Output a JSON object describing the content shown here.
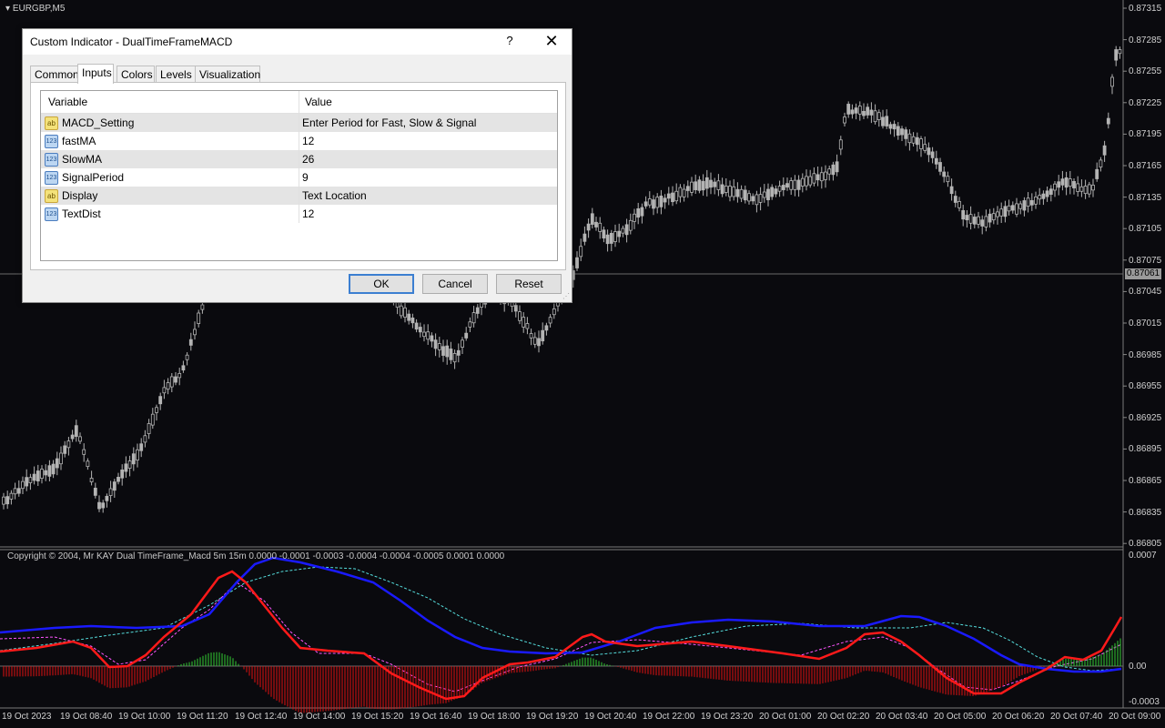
{
  "chart": {
    "symbol": "EURGBP,M5",
    "current_price": "0.87061",
    "price_axis": [
      "0.87315",
      "0.87285",
      "0.87255",
      "0.87225",
      "0.87195",
      "0.87165",
      "0.87135",
      "0.87105",
      "0.87075",
      "0.87045",
      "0.87015",
      "0.86985",
      "0.86955",
      "0.86925",
      "0.86895",
      "0.86865",
      "0.86835",
      "0.86805"
    ],
    "time_axis": [
      "19 Oct 2023",
      "19 Oct 08:40",
      "19 Oct 10:00",
      "19 Oct 11:20",
      "19 Oct 12:40",
      "19 Oct 14:00",
      "19 Oct 15:20",
      "19 Oct 16:40",
      "19 Oct 18:00",
      "19 Oct 19:20",
      "19 Oct 20:40",
      "19 Oct 22:00",
      "19 Oct 23:20",
      "20 Oct 01:00",
      "20 Oct 02:20",
      "20 Oct 03:40",
      "20 Oct 05:00",
      "20 Oct 06:20",
      "20 Oct 07:40",
      "20 Oct 09:00"
    ],
    "subwindow_caption": "Copyright © 2004, Mr KAY Dual TimeFrame_Macd 5m 15m  0.0000 -0.0001 -0.0003 -0.0004 -0.0004 -0.0005 0.0001 0.0000",
    "subwindow_axis": [
      "0.0007",
      "0.00",
      "-0.0003"
    ],
    "colors": {
      "background": "#0a0a0e",
      "candles": "#b4b4b4",
      "macd_fast": "#ff1a1a",
      "macd_slow": "#1a1aff",
      "signal_pink": "#ff55ff",
      "signal_cyan": "#55dddd",
      "hist_up": "#33cc33",
      "hist_down": "#e01010"
    }
  },
  "dialog": {
    "title": "Custom Indicator - DualTimeFrameMACD",
    "help": "?",
    "close": "✕",
    "tabs": [
      "Common",
      "Inputs",
      "Colors",
      "Levels",
      "Visualization"
    ],
    "active_tab": "Inputs",
    "columns": [
      "Variable",
      "Value"
    ],
    "rows": [
      {
        "type": "ab",
        "icon": "ab",
        "variable": "MACD_Setting",
        "value": "Enter Period for Fast, Slow & Signal"
      },
      {
        "type": "num",
        "icon": "123",
        "variable": "fastMA",
        "value": "12"
      },
      {
        "type": "num",
        "icon": "123",
        "variable": "SlowMA",
        "value": "26"
      },
      {
        "type": "num",
        "icon": "123",
        "variable": "SignalPeriod",
        "value": "9"
      },
      {
        "type": "ab",
        "icon": "ab",
        "variable": "Display",
        "value": "Text Location"
      },
      {
        "type": "num",
        "icon": "123",
        "variable": "TextDist",
        "value": "12"
      }
    ],
    "buttons": {
      "ok": "OK",
      "cancel": "Cancel",
      "reset": "Reset"
    }
  }
}
